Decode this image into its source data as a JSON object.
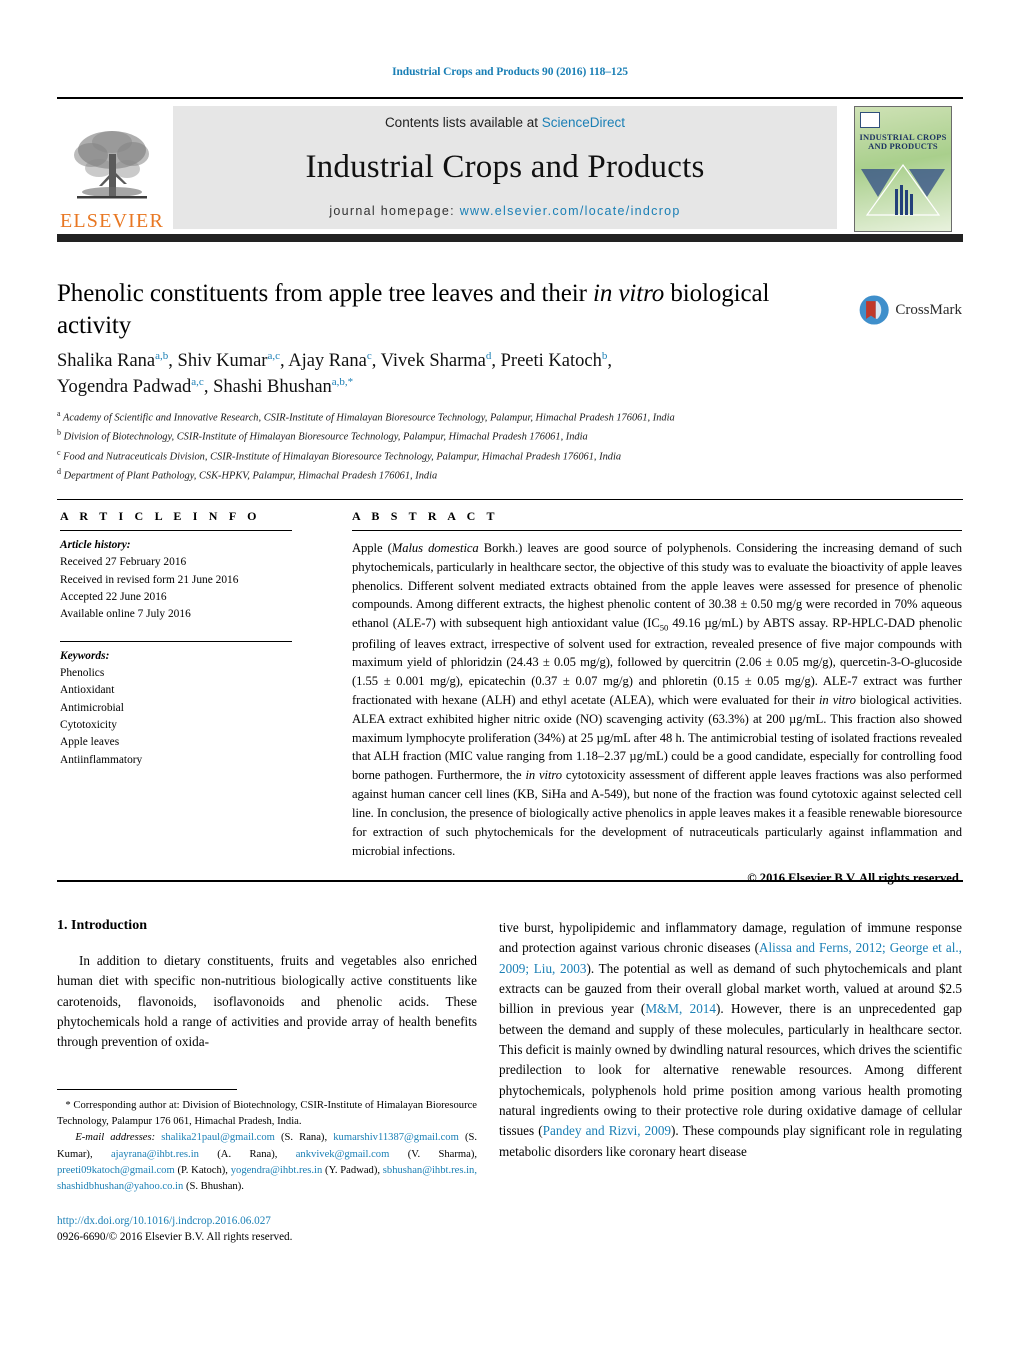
{
  "running_head": "Industrial Crops and Products 90 (2016) 118–125",
  "masthead": {
    "publisher_name": "ELSEVIER",
    "contents_prefix": "Contents lists available at ",
    "contents_link": "ScienceDirect",
    "journal_name": "Industrial Crops and Products",
    "homepage_prefix": "journal homepage: ",
    "homepage_url": "www.elsevier.com/locate/indcrop",
    "cover_title_line1": "INDUSTRIAL CROPS",
    "cover_title_line2": "AND PRODUCTS"
  },
  "crossmark": {
    "label": "CrossMark"
  },
  "title": {
    "part1": "Phenolic constituents from apple tree leaves and their ",
    "italic": "in vitro",
    "part2": " biological activity"
  },
  "authors_line1": "Shalika Rana",
  "authors": [
    {
      "name": "Shalika Rana",
      "sup": "a,b"
    },
    {
      "name": "Shiv Kumar",
      "sup": "a,c"
    },
    {
      "name": "Ajay Rana",
      "sup": "c"
    },
    {
      "name": "Vivek Sharma",
      "sup": "d"
    },
    {
      "name": "Preeti Katoch",
      "sup": "b"
    },
    {
      "name": "Yogendra Padwad",
      "sup": "a,c"
    },
    {
      "name": "Shashi Bhushan",
      "sup": "a,b,*"
    }
  ],
  "affiliations": [
    {
      "mark": "a",
      "text": "Academy of Scientific and Innovative Research, CSIR-Institute of Himalayan Bioresource Technology, Palampur, Himachal Pradesh 176061, India"
    },
    {
      "mark": "b",
      "text": "Division of Biotechnology, CSIR-Institute of Himalayan Bioresource Technology, Palampur, Himachal Pradesh 176061, India"
    },
    {
      "mark": "c",
      "text": "Food and Nutraceuticals Division, CSIR-Institute of Himalayan Bioresource Technology, Palampur, Himachal Pradesh 176061, India"
    },
    {
      "mark": "d",
      "text": "Department of Plant Pathology, CSK-HPKV, Palampur, Himachal Pradesh 176061, India"
    }
  ],
  "article_info": {
    "heading": "A R T I C L E    I N F O",
    "history_label": "Article history:",
    "history": [
      "Received 27 February 2016",
      "Received in revised form 21 June 2016",
      "Accepted 22 June 2016",
      "Available online 7 July 2016"
    ],
    "keywords_label": "Keywords:",
    "keywords": [
      "Phenolics",
      "Antioxidant",
      "Antimicrobial",
      "Cytotoxicity",
      "Apple leaves",
      "Antiinflammatory"
    ]
  },
  "abstract": {
    "heading": "A B S T R A C T",
    "text_before_species": "Apple (",
    "species": "Malus domestica",
    "text_after_species": " Borkh.) leaves are good source of polyphenols. Considering the increasing demand of such phytochemicals, particularly in healthcare sector, the objective of this study was to evaluate the bioactivity of apple leaves phenolics. Different solvent mediated extracts obtained from the apple leaves were assessed for presence of phenolic compounds. Among different extracts, the highest phenolic content of 30.38 ± 0.50 mg/g were recorded in 70% aqueous ethanol (ALE-7) with subsequent high antioxidant value (IC",
    "ic_sub": "50",
    "text_part3": " 49.16 µg/mL) by ABTS assay. RP-HPLC-DAD phenolic profiling of leaves extract, irrespective of solvent used for extraction, revealed presence of five major compounds with maximum yield of phloridzin (24.43 ± 0.05 mg/g), followed by quercitrin (2.06 ± 0.05 mg/g), quercetin-3-O-glucoside (1.55 ± 0.001 mg/g), epicatechin (0.37 ± 0.07 mg/g) and phloretin (0.15 ± 0.05 mg/g). ALE-7 extract was further fractionated with hexane (ALH) and ethyl acetate (ALEA), which were evaluated for their ",
    "invitro1": "in vitro",
    "text_part4": " biological activities. ALEA extract exhibited higher nitric oxide (NO) scavenging activity (63.3%) at 200 µg/mL. This fraction also showed maximum lymphocyte proliferation (34%) at 25 µg/mL after 48 h. The antimicrobial testing of isolated fractions revealed that ALH fraction (MIC value ranging from 1.18–2.37 µg/mL) could be a good candidate, especially for controlling food borne pathogen. Furthermore, the ",
    "invitro2": "in vitro",
    "text_part5": " cytotoxicity assessment of different apple leaves fractions was also performed against human cancer cell lines (KB, SiHa and A-549), but none of the fraction was found cytotoxic against selected cell line. In conclusion, the presence of biologically active phenolics in apple leaves makes it a feasible renewable bioresource for extraction of such phytochemicals for the development of nutraceuticals particularly against inflammation and microbial infections.",
    "copyright": "© 2016 Elsevier B.V. All rights reserved."
  },
  "introduction": {
    "heading": "1.  Introduction",
    "left_paragraph": "In addition to dietary constituents, fruits and vegetables also enriched human diet with specific non-nutritious biologically active constituents like carotenoids, flavonoids, isoflavonoids and phenolic acids. These phytochemicals hold a range of activities and provide array of health benefits through prevention of oxida-",
    "right_part1": "tive burst, hypolipidemic and inflammatory damage, regulation of immune response and protection against various chronic diseases (",
    "right_ref1": "Alissa and Ferns, 2012; George et al., 2009; Liu, 2003",
    "right_part2": "). The potential as well as demand of such phytochemicals and plant extracts can be gauzed from their overall global market worth, valued at around $2.5 billion in previous year (",
    "right_ref2": "M&M, 2014",
    "right_part3": "). However, there is an unprecedented gap between the demand and supply of these molecules, particularly in healthcare sector. This deficit is mainly owned by dwindling natural resources, which drives the scientific predilection to look for alternative renewable resources. Among different phytochemicals, polyphenols hold prime position among various health promoting natural ingredients owing to their protective role during oxidative damage of cellular tissues (",
    "right_ref3": "Pandey and Rizvi, 2009",
    "right_part4": "). These compounds play significant role in regulating metabolic disorders like coronary heart disease"
  },
  "footnotes": {
    "corresponding": "* Corresponding author at: Division of Biotechnology, CSIR-Institute of Himalayan Bioresource Technology, Palampur 176 061, Himachal Pradesh, India.",
    "email_label": "E-mail addresses:",
    "emails": [
      {
        "address": "shalika21paul@gmail.com",
        "owner": "(S. Rana),"
      },
      {
        "address": "kumarshiv11387@gmail.com",
        "owner": "(S. Kumar),"
      },
      {
        "address": "ajayrana@ihbt.res.in",
        "owner": "(A. Rana),"
      },
      {
        "address": "ankvivek@gmail.com",
        "owner": "(V. Sharma),"
      },
      {
        "address": "preeti09katoch@gmail.com",
        "owner": "(P. Katoch),"
      },
      {
        "address": "yogendra@ihbt.res.in",
        "owner": "(Y. Padwad),"
      },
      {
        "address": "sbhushan@ihbt.res.in,",
        "owner": ""
      },
      {
        "address": "shashidbhushan@yahoo.co.in",
        "owner": "(S. Bhushan)."
      }
    ],
    "doi": "http://dx.doi.org/10.1016/j.indcrop.2016.06.027",
    "issn": "0926-6690/© 2016 Elsevier B.V. All rights reserved."
  },
  "colors": {
    "link": "#1a7fb5",
    "elsevier_orange": "#e87722",
    "band_gray": "#e6e6e6",
    "bar_black": "#222222"
  }
}
